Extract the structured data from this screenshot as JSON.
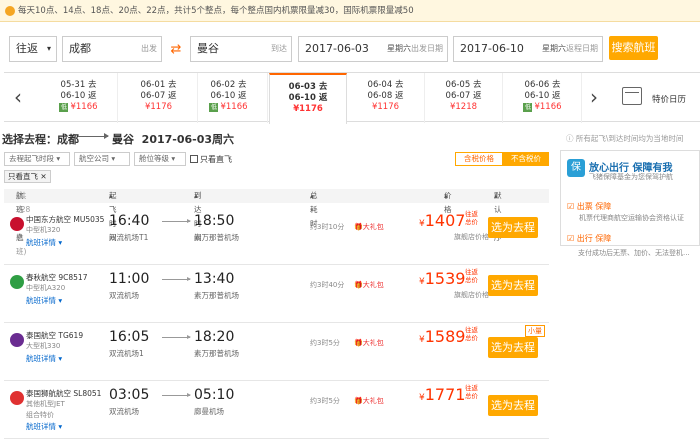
{
  "notice": "每天10点、14点、18点、20点、22点，共计5个整点，每个整点国内机票限量减30，国际机票限量减50",
  "search": {
    "trip_type": "往返",
    "from": "成都",
    "from_sub": "出发",
    "to": "曼谷",
    "to_sub": "到达",
    "depart_date": "2017-06-03",
    "depart_weekday": "星期六",
    "depart_sub": "出发日期",
    "return_date": "2017-06-10",
    "return_weekday": "星期六",
    "return_sub": "返程日期",
    "button": "搜索航班"
  },
  "date_strip": {
    "items": [
      {
        "go": "05-31 去",
        "back": "06-10 返",
        "price": "¥1166",
        "low": true
      },
      {
        "go": "06-01 去",
        "back": "06-07 返",
        "price": "¥1176",
        "low": false
      },
      {
        "go": "06-02 去",
        "back": "06-10 返",
        "price": "¥1166",
        "low": true
      },
      {
        "go": "06-03 去",
        "back": "06-10 返",
        "price": "¥1176",
        "low": false,
        "active": true
      },
      {
        "go": "06-04 去",
        "back": "06-08 返",
        "price": "¥1176",
        "low": false
      },
      {
        "go": "06-05 去",
        "back": "06-07 返",
        "price": "¥1218",
        "low": false
      },
      {
        "go": "06-06 去",
        "back": "06-10 返",
        "price": "¥1166",
        "low": true
      }
    ],
    "low_badge": "低",
    "calendar_label": "特价日历"
  },
  "trip_title": {
    "prefix": "选择去程：成都",
    "dest": "曼谷",
    "date": "2017-06-03周六"
  },
  "tip": "所有起飞\\到达时间均为当地时间",
  "filters": [
    "去程起飞时段",
    "航空公司",
    "舱位等级"
  ],
  "direct_only": "只看直飞",
  "price_toggle": {
    "off": "含税价格",
    "on": "不含税价"
  },
  "chip": "只看直飞",
  "headers": {
    "info": "航班信息",
    "count": "(共228条航班)",
    "dep": "起飞时间",
    "arr": "到达时间",
    "dur": "总耗时",
    "price": "价格",
    "sort": "默认排序"
  },
  "flights": [
    {
      "airline": "中国东方航空 MU5035",
      "plane": "中型机320",
      "extra": "",
      "detail": "航班详情",
      "dep": "16:40",
      "dep_ap": "双流机场T1",
      "arr": "18:50",
      "arr_ap": "素万那普机场",
      "dur": "约3时10分",
      "gift": "大礼包",
      "price": "1407",
      "tag": "往返总价",
      "store": "旗舰店价格",
      "button": "选为去程",
      "logo": "#c8102e"
    },
    {
      "airline": "春秋航空 9C8517",
      "plane": "中型机A320",
      "extra": "",
      "detail": "航班详情",
      "dep": "11:00",
      "dep_ap": "双流机场",
      "arr": "13:40",
      "arr_ap": "素万那普机场",
      "dur": "约3时40分",
      "gift": "大礼包",
      "price": "1539",
      "tag": "往返总价",
      "store": "旗舰店价格",
      "button": "选为去程",
      "logo": "#2f9e44"
    },
    {
      "airline": "泰国航空 TG619",
      "plane": "大型机330",
      "extra": "",
      "detail": "航班详情",
      "dep": "16:05",
      "dep_ap": "双流机场1",
      "arr": "18:20",
      "arr_ap": "素万那普机场",
      "dur": "约3时5分",
      "gift": "大礼包",
      "price": "1589",
      "tag": "往返总价",
      "store": "",
      "button": "选为去程",
      "badge": "小量",
      "logo": "#6a2c91"
    },
    {
      "airline": "泰国狮航航空 SL8051",
      "plane": "其他机型JET",
      "extra": "组合特价",
      "detail": "航班详情",
      "dep": "03:05",
      "dep_ap": "双流机场",
      "arr": "05:10",
      "arr_ap": "廊曼机场",
      "dur": "约3时5分",
      "gift": "大礼包",
      "price": "1771",
      "tag": "往返总价",
      "store": "",
      "button": "选为去程",
      "logo": "#e03131"
    }
  ],
  "side": {
    "promo_title": "放心出行 保障有我",
    "promo_sub": "飞猪保障基金为您保驾护航",
    "item1_title": "出票 保障",
    "item1_text": "机票代理商航空运输协会资格认证",
    "item2_title": "出行 保障",
    "item2_text": "支付成功后无票、加价、无法登机..."
  }
}
